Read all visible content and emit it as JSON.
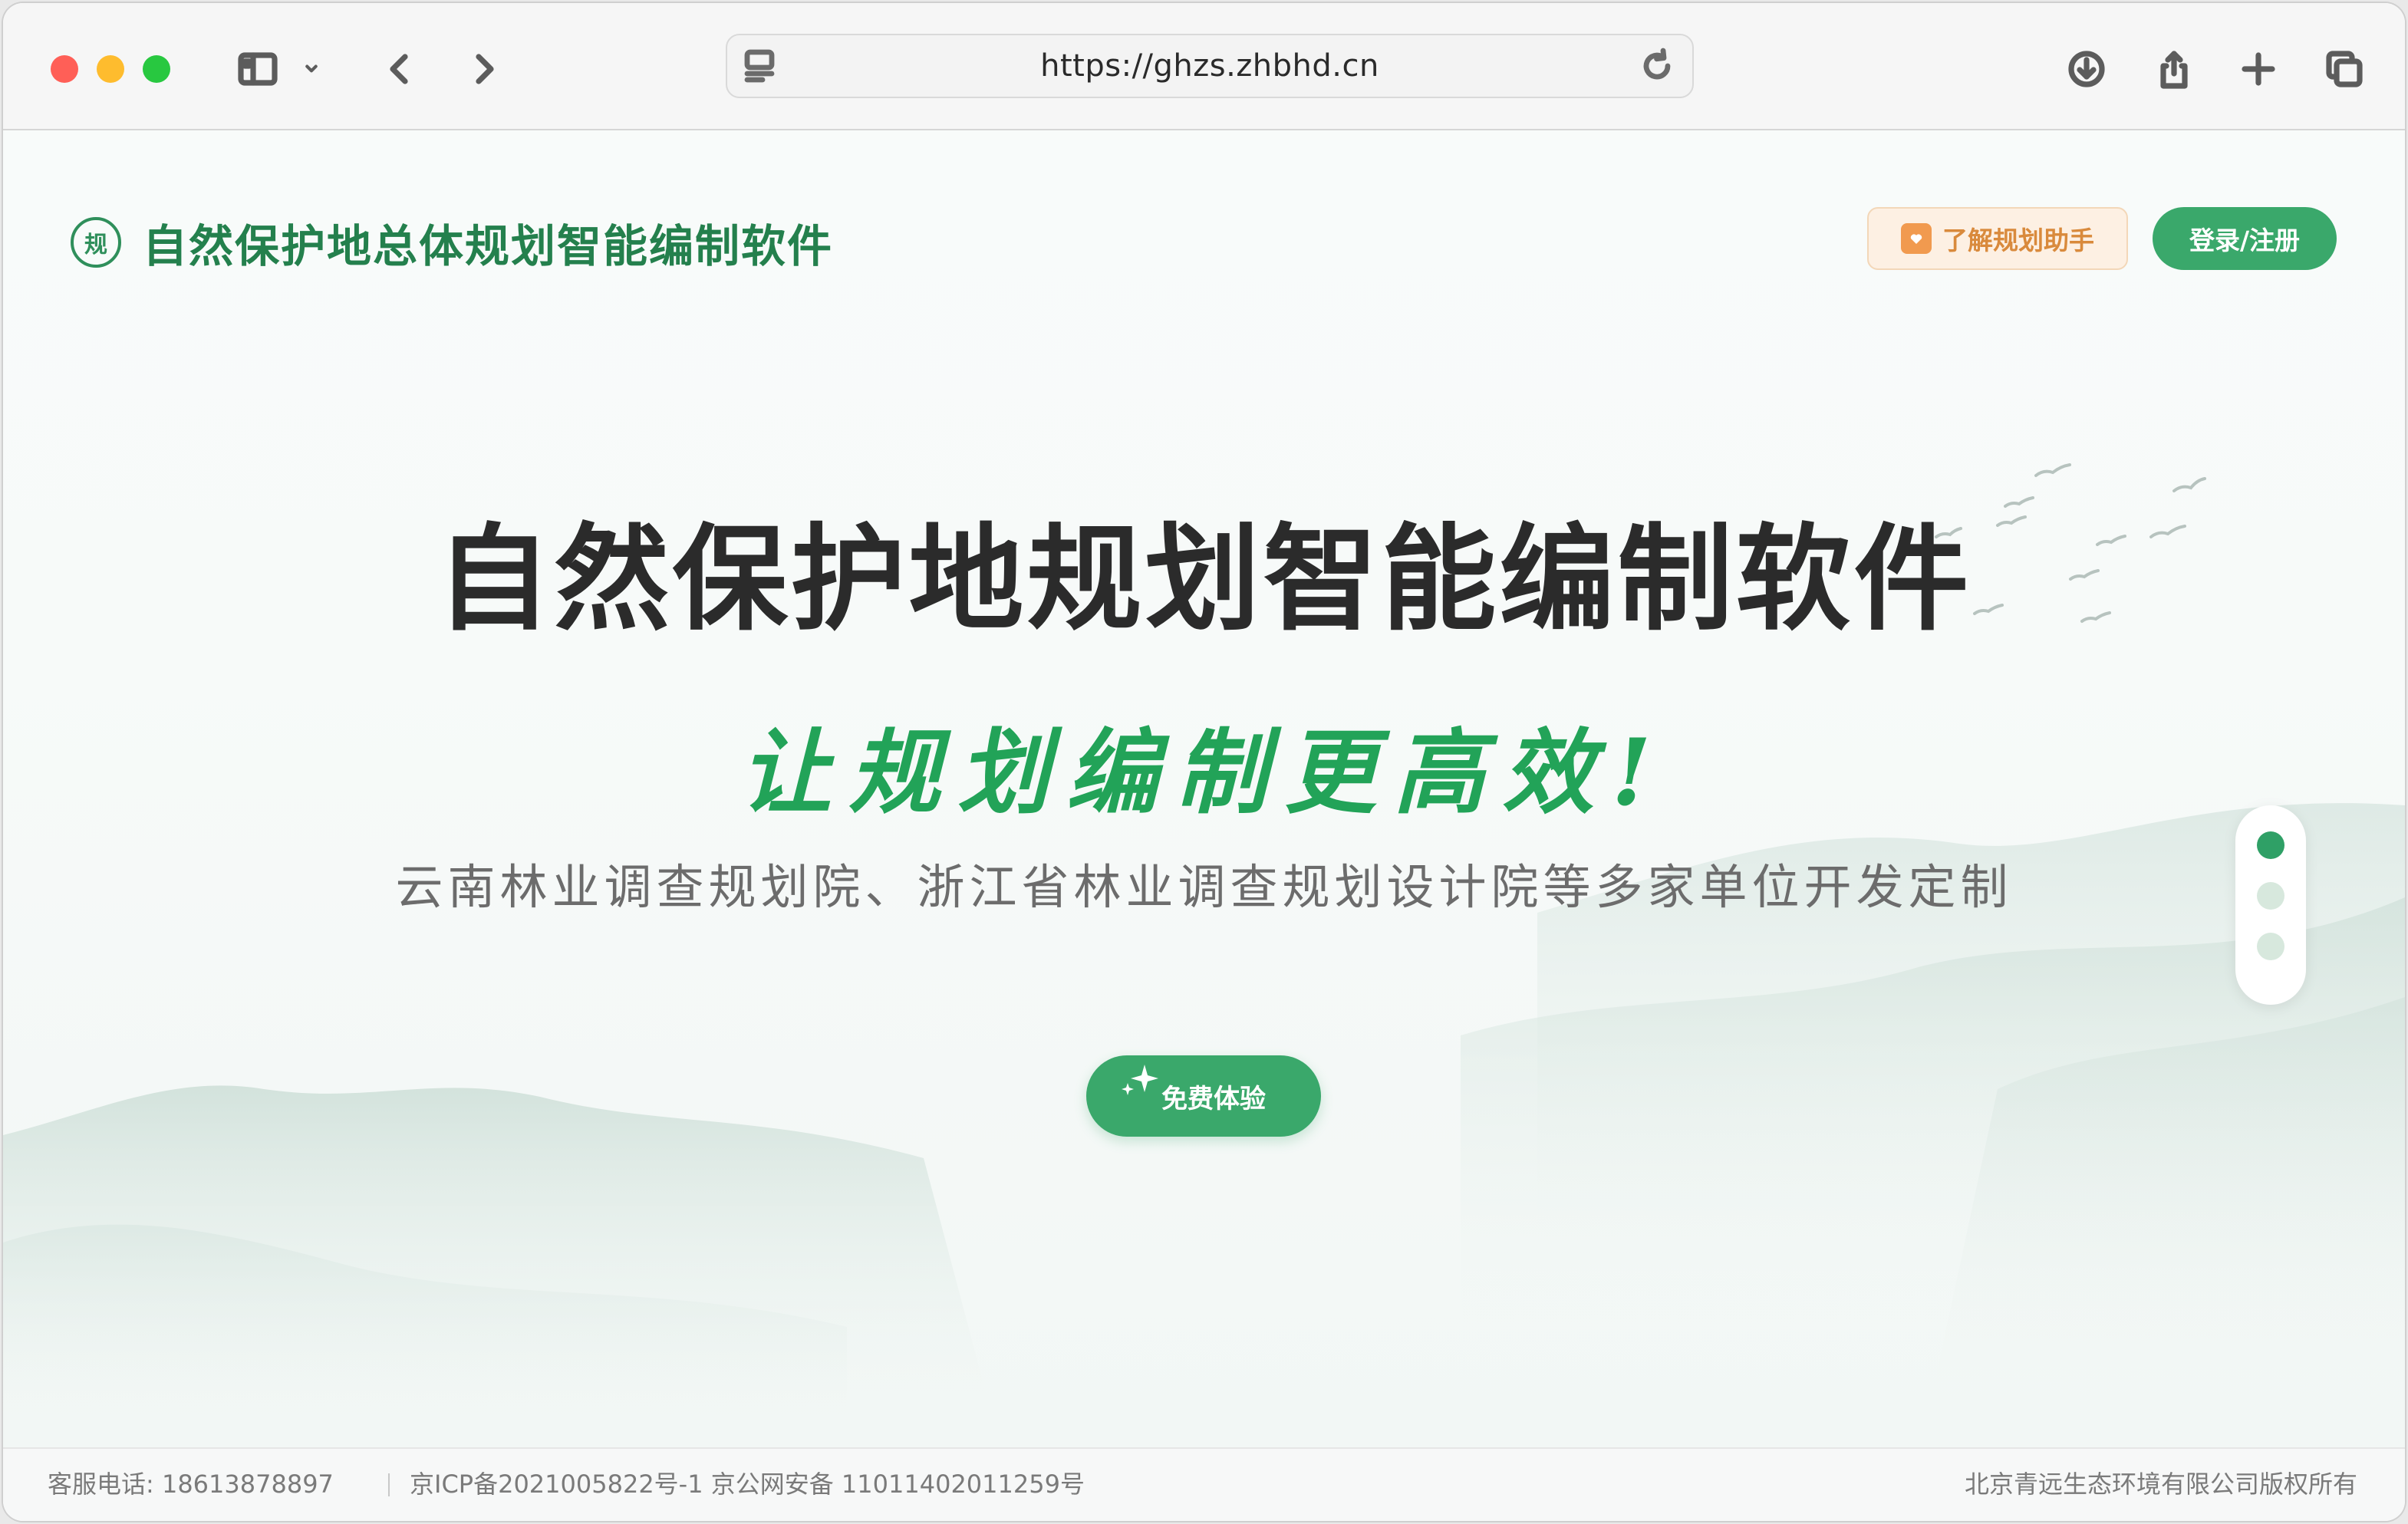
{
  "browser": {
    "url": "https://ghzs.zhbhd.cn"
  },
  "header": {
    "logo_text": "规",
    "title": "自然保护地总体规划智能编制软件",
    "assistant_button": "了解规划助手",
    "login_button": "登录/注册"
  },
  "hero": {
    "title": "自然保护地规划智能编制软件",
    "slogan": "让规划编制更高效!",
    "subtitle": "云南林业调查规划院、浙江省林业调查规划设计院等多家单位开发定制",
    "try_button": "免费体验"
  },
  "carousel": {
    "slide_count": 3,
    "active_index": 0
  },
  "footer": {
    "phone": "客服电话: 18613878897",
    "icp": "京ICP备2021005822号-1 京公网安备 11011402011259号",
    "copyright": "北京青远生态环境有限公司版权所有"
  },
  "colors": {
    "brand_green": "#3aa86b",
    "title_green": "#24804d",
    "slogan_green": "#22a358",
    "assist_orange": "#d98a3c"
  }
}
